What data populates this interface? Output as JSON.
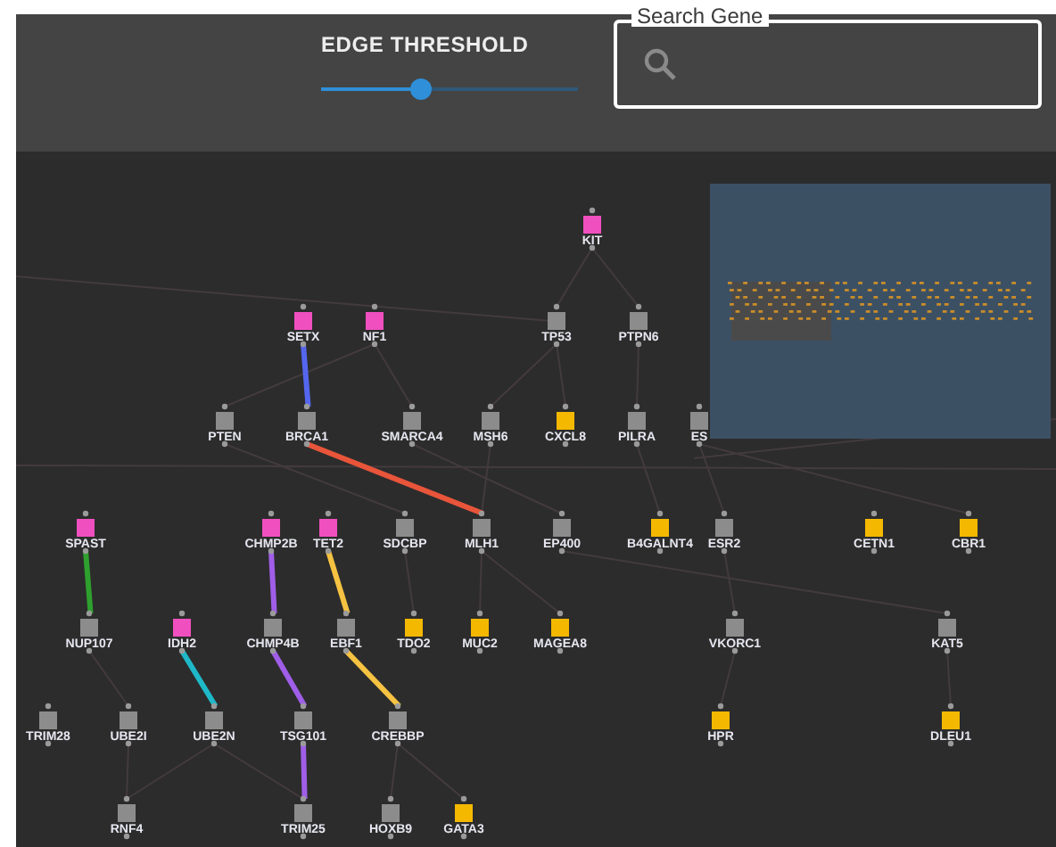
{
  "header": {
    "threshold_label": "EDGE THRESHOLD",
    "threshold": {
      "level": 0.39
    },
    "search": {
      "placeholder": "Search Gene"
    }
  },
  "graph": {
    "nodes": [
      {
        "label": "KIT",
        "color": "#f04fbf"
      },
      {
        "label": "SETX",
        "color": "#f04fbf"
      },
      {
        "label": "NF1",
        "color": "#f04fbf"
      },
      {
        "label": "TP53",
        "color": "#8c8c8c"
      },
      {
        "label": "PTPN6",
        "color": "#8c8c8c"
      },
      {
        "label": "PTEN",
        "color": "#8c8c8c"
      },
      {
        "label": "BRCA1",
        "color": "#8c8c8c"
      },
      {
        "label": "SMARCA4",
        "color": "#8c8c8c"
      },
      {
        "label": "MSH6",
        "color": "#8c8c8c"
      },
      {
        "label": "CXCL8",
        "color": "#f5b800"
      },
      {
        "label": "PILRA",
        "color": "#8c8c8c"
      },
      {
        "label": "ES",
        "color": "#8c8c8c"
      },
      {
        "label": "SPAST",
        "color": "#f04fbf"
      },
      {
        "label": "CHMP2B",
        "color": "#f04fbf"
      },
      {
        "label": "TET2",
        "color": "#f04fbf"
      },
      {
        "label": "SDCBP",
        "color": "#8c8c8c"
      },
      {
        "label": "MLH1",
        "color": "#8c8c8c"
      },
      {
        "label": "EP400",
        "color": "#8c8c8c"
      },
      {
        "label": "B4GALNT4",
        "color": "#f5b800"
      },
      {
        "label": "ESR2",
        "color": "#8c8c8c"
      },
      {
        "label": "CETN1",
        "color": "#f5b800"
      },
      {
        "label": "CBR1",
        "color": "#f5b800"
      },
      {
        "label": "NUP107",
        "color": "#8c8c8c"
      },
      {
        "label": "IDH2",
        "color": "#f04fbf"
      },
      {
        "label": "CHMP4B",
        "color": "#8c8c8c"
      },
      {
        "label": "EBF1",
        "color": "#8c8c8c"
      },
      {
        "label": "TDO2",
        "color": "#f5b800"
      },
      {
        "label": "MUC2",
        "color": "#f5b800"
      },
      {
        "label": "MAGEA8",
        "color": "#f5b800"
      },
      {
        "label": "VKORC1",
        "color": "#8c8c8c"
      },
      {
        "label": "KAT5",
        "color": "#8c8c8c"
      },
      {
        "label": "TRIM28",
        "color": "#8c8c8c"
      },
      {
        "label": "UBE2I",
        "color": "#8c8c8c"
      },
      {
        "label": "UBE2N",
        "color": "#8c8c8c"
      },
      {
        "label": "TSG101",
        "color": "#8c8c8c"
      },
      {
        "label": "CREBBP",
        "color": "#8c8c8c"
      },
      {
        "label": "HPR",
        "color": "#f5b800"
      },
      {
        "label": "DLEU1",
        "color": "#f5b800"
      },
      {
        "label": "RNF4",
        "color": "#8c8c8c"
      },
      {
        "label": "TRIM25",
        "color": "#8c8c8c"
      },
      {
        "label": "HOXB9",
        "color": "#8c8c8c"
      },
      {
        "label": "GATA3",
        "color": "#f5b800"
      }
    ],
    "edges": [
      {
        "color": "#5566ee"
      },
      {
        "color": "#e8553a"
      },
      {
        "color": "#2ea02e"
      },
      {
        "color": "#1fb8c8"
      },
      {
        "color": "#a05ee8"
      },
      {
        "color": "#a05ee8"
      },
      {
        "color": "#a05ee8"
      },
      {
        "color": "#f5c242"
      },
      {
        "color": "#f5c242"
      }
    ]
  }
}
